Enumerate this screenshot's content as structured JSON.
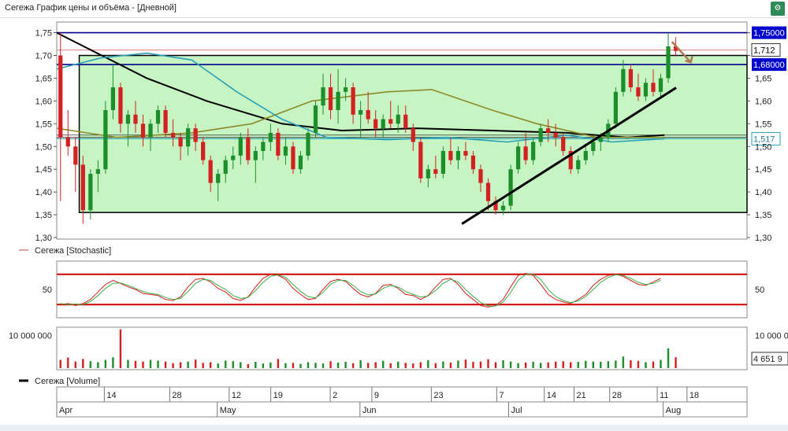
{
  "window": {
    "title": "Сегежа График цены и объёма - [Дневной]",
    "corner_icon": "chart-settings-icon"
  },
  "colors": {
    "up_candle": "#1c8f2b",
    "down_candle": "#d42020",
    "range_box_fill": "#c6f5c3",
    "blue_line": "#00008b",
    "red_line": "#d98080",
    "ma_black": "#000000",
    "ma_olive": "#8b8b2a",
    "ma_teal": "#2aa0b8",
    "stoch_k": "#d42020",
    "stoch_d": "#3cb043",
    "stoch_band": "#d00000",
    "arrow": "#b07850"
  },
  "chart_data": [
    {
      "type": "candlestick",
      "pane": "price",
      "ylim": [
        1.3,
        1.77
      ],
      "y_ticks": [
        "1,30",
        "1,35",
        "1,40",
        "1,45",
        "1,50",
        "1,55",
        "1,60",
        "1,65",
        "1,70",
        "1,75"
      ],
      "grid": false,
      "ohlc": [
        [
          1.7,
          1.75,
          1.38,
          1.52
        ],
        [
          1.52,
          1.58,
          1.48,
          1.5
        ],
        [
          1.5,
          1.52,
          1.4,
          1.46
        ],
        [
          1.46,
          1.48,
          1.33,
          1.36
        ],
        [
          1.36,
          1.45,
          1.34,
          1.44
        ],
        [
          1.44,
          1.47,
          1.4,
          1.45
        ],
        [
          1.45,
          1.6,
          1.44,
          1.58
        ],
        [
          1.58,
          1.68,
          1.56,
          1.63
        ],
        [
          1.63,
          1.64,
          1.53,
          1.55
        ],
        [
          1.55,
          1.58,
          1.5,
          1.57
        ],
        [
          1.57,
          1.6,
          1.53,
          1.55
        ],
        [
          1.55,
          1.57,
          1.5,
          1.52
        ],
        [
          1.52,
          1.56,
          1.49,
          1.55
        ],
        [
          1.55,
          1.59,
          1.53,
          1.58
        ],
        [
          1.58,
          1.59,
          1.52,
          1.53
        ],
        [
          1.53,
          1.56,
          1.5,
          1.52
        ],
        [
          1.52,
          1.53,
          1.47,
          1.5
        ],
        [
          1.5,
          1.55,
          1.48,
          1.54
        ],
        [
          1.54,
          1.55,
          1.49,
          1.51
        ],
        [
          1.51,
          1.52,
          1.46,
          1.47
        ],
        [
          1.47,
          1.48,
          1.4,
          1.42
        ],
        [
          1.42,
          1.45,
          1.38,
          1.44
        ],
        [
          1.44,
          1.48,
          1.42,
          1.47
        ],
        [
          1.47,
          1.5,
          1.45,
          1.48
        ],
        [
          1.48,
          1.53,
          1.46,
          1.52
        ],
        [
          1.52,
          1.54,
          1.46,
          1.47
        ],
        [
          1.47,
          1.5,
          1.42,
          1.49
        ],
        [
          1.49,
          1.52,
          1.47,
          1.51
        ],
        [
          1.51,
          1.55,
          1.49,
          1.53
        ],
        [
          1.53,
          1.54,
          1.47,
          1.48
        ],
        [
          1.48,
          1.52,
          1.46,
          1.5
        ],
        [
          1.5,
          1.51,
          1.44,
          1.45
        ],
        [
          1.45,
          1.49,
          1.44,
          1.48
        ],
        [
          1.48,
          1.54,
          1.47,
          1.53
        ],
        [
          1.53,
          1.6,
          1.52,
          1.59
        ],
        [
          1.59,
          1.66,
          1.57,
          1.63
        ],
        [
          1.63,
          1.66,
          1.56,
          1.58
        ],
        [
          1.58,
          1.67,
          1.55,
          1.62
        ],
        [
          1.62,
          1.65,
          1.6,
          1.63
        ],
        [
          1.63,
          1.64,
          1.55,
          1.57
        ],
        [
          1.57,
          1.6,
          1.52,
          1.58
        ],
        [
          1.58,
          1.62,
          1.55,
          1.56
        ],
        [
          1.56,
          1.58,
          1.52,
          1.54
        ],
        [
          1.54,
          1.57,
          1.52,
          1.56
        ],
        [
          1.56,
          1.6,
          1.54,
          1.55
        ],
        [
          1.55,
          1.59,
          1.53,
          1.57
        ],
        [
          1.57,
          1.59,
          1.53,
          1.54
        ],
        [
          1.54,
          1.55,
          1.49,
          1.51
        ],
        [
          1.51,
          1.52,
          1.42,
          1.43
        ],
        [
          1.43,
          1.46,
          1.41,
          1.45
        ],
        [
          1.45,
          1.48,
          1.43,
          1.44
        ],
        [
          1.44,
          1.5,
          1.43,
          1.49
        ],
        [
          1.49,
          1.52,
          1.46,
          1.47
        ],
        [
          1.47,
          1.5,
          1.45,
          1.49
        ],
        [
          1.49,
          1.51,
          1.47,
          1.48
        ],
        [
          1.48,
          1.49,
          1.44,
          1.45
        ],
        [
          1.45,
          1.46,
          1.4,
          1.42
        ],
        [
          1.42,
          1.43,
          1.36,
          1.38
        ],
        [
          1.38,
          1.39,
          1.35,
          1.36
        ],
        [
          1.36,
          1.38,
          1.35,
          1.37
        ],
        [
          1.37,
          1.46,
          1.36,
          1.45
        ],
        [
          1.45,
          1.51,
          1.44,
          1.5
        ],
        [
          1.5,
          1.53,
          1.46,
          1.47
        ],
        [
          1.47,
          1.52,
          1.46,
          1.51
        ],
        [
          1.51,
          1.55,
          1.5,
          1.54
        ],
        [
          1.54,
          1.56,
          1.51,
          1.53
        ],
        [
          1.53,
          1.55,
          1.5,
          1.52
        ],
        [
          1.52,
          1.53,
          1.48,
          1.49
        ],
        [
          1.49,
          1.5,
          1.44,
          1.45
        ],
        [
          1.45,
          1.48,
          1.44,
          1.47
        ],
        [
          1.47,
          1.5,
          1.46,
          1.49
        ],
        [
          1.49,
          1.52,
          1.48,
          1.51
        ],
        [
          1.51,
          1.53,
          1.49,
          1.52
        ],
        [
          1.52,
          1.56,
          1.51,
          1.55
        ],
        [
          1.55,
          1.63,
          1.54,
          1.62
        ],
        [
          1.62,
          1.69,
          1.61,
          1.67
        ],
        [
          1.67,
          1.68,
          1.62,
          1.63
        ],
        [
          1.63,
          1.66,
          1.6,
          1.61
        ],
        [
          1.61,
          1.65,
          1.6,
          1.64
        ],
        [
          1.64,
          1.67,
          1.61,
          1.62
        ],
        [
          1.62,
          1.66,
          1.61,
          1.65
        ],
        [
          1.65,
          1.75,
          1.64,
          1.72
        ],
        [
          1.72,
          1.74,
          1.7,
          1.71
        ]
      ],
      "x_range": [
        0,
        92
      ],
      "range_box": {
        "x1": 3,
        "x2": 92,
        "y_low": 1.355,
        "y_high": 1.7
      },
      "levels": [
        {
          "y": 1.75,
          "label": "1,75000",
          "style": "blue"
        },
        {
          "y": 1.68,
          "label": "1,68000",
          "style": "blue"
        },
        {
          "y": 1.712,
          "label": "1,712",
          "style": "red"
        },
        {
          "y": 1.517,
          "label": "1,517",
          "style": "teal-box"
        },
        {
          "y": 1.525,
          "style": "dark"
        },
        {
          "y": 1.52,
          "style": "dark"
        }
      ],
      "trendlines": [
        {
          "x1": 54,
          "y1": 1.33,
          "x2": 96,
          "y2": 1.77
        }
      ],
      "arrow": {
        "x1": 82,
        "y1": 1.73,
        "x2": 84.5,
        "y2": 1.685
      },
      "moving_averages": [
        {
          "color": "black",
          "points": [
            [
              0,
              1.75
            ],
            [
              6,
              1.7
            ],
            [
              12,
              1.65
            ],
            [
              20,
              1.6
            ],
            [
              30,
              1.55
            ],
            [
              38,
              1.535
            ],
            [
              48,
              1.54
            ],
            [
              58,
              1.535
            ],
            [
              68,
              1.53
            ],
            [
              76,
              1.52
            ],
            [
              81,
              1.525
            ]
          ]
        },
        {
          "color": "olive",
          "points": [
            [
              0,
              1.54
            ],
            [
              8,
              1.52
            ],
            [
              18,
              1.53
            ],
            [
              26,
              1.55
            ],
            [
              34,
              1.6
            ],
            [
              44,
              1.62
            ],
            [
              50,
              1.625
            ],
            [
              58,
              1.58
            ],
            [
              64,
              1.55
            ],
            [
              72,
              1.52
            ],
            [
              81,
              1.52
            ]
          ]
        },
        {
          "color": "teal",
          "points": [
            [
              0,
              1.67
            ],
            [
              6,
              1.695
            ],
            [
              12,
              1.705
            ],
            [
              18,
              1.69
            ],
            [
              24,
              1.62
            ],
            [
              30,
              1.56
            ],
            [
              36,
              1.52
            ],
            [
              44,
              1.515
            ],
            [
              52,
              1.52
            ],
            [
              60,
              1.51
            ],
            [
              68,
              1.525
            ],
            [
              74,
              1.51
            ],
            [
              81,
              1.517
            ]
          ]
        }
      ]
    },
    {
      "type": "line",
      "pane": "stochastic",
      "title": "Сегежа [Stochastic]",
      "ylim": [
        0,
        100
      ],
      "y_ticks": [
        "50"
      ],
      "bands": [
        80,
        20
      ],
      "series": [
        {
          "color": "red",
          "values": [
            20,
            22,
            18,
            22,
            30,
            45,
            60,
            68,
            62,
            55,
            50,
            42,
            40,
            38,
            30,
            28,
            35,
            55,
            70,
            72,
            65,
            52,
            45,
            32,
            28,
            35,
            55,
            72,
            80,
            78,
            70,
            52,
            40,
            30,
            32,
            50,
            66,
            70,
            66,
            52,
            40,
            35,
            42,
            58,
            60,
            52,
            40,
            38,
            30,
            38,
            55,
            70,
            72,
            60,
            42,
            30,
            18,
            15,
            18,
            30,
            55,
            78,
            82,
            78,
            60,
            40,
            30,
            25,
            22,
            30,
            40,
            58,
            70,
            78,
            80,
            76,
            68,
            60,
            58,
            65,
            72
          ]
        },
        {
          "color": "green",
          "values": [
            22,
            20,
            21,
            20,
            26,
            38,
            52,
            62,
            63,
            58,
            52,
            46,
            42,
            40,
            34,
            30,
            32,
            46,
            62,
            70,
            68,
            58,
            50,
            38,
            32,
            34,
            48,
            64,
            76,
            79,
            74,
            60,
            46,
            36,
            33,
            44,
            60,
            68,
            68,
            58,
            46,
            39,
            41,
            52,
            58,
            55,
            46,
            40,
            35,
            37,
            48,
            62,
            70,
            65,
            50,
            36,
            24,
            17,
            17,
            25,
            44,
            68,
            80,
            80,
            70,
            50,
            36,
            28,
            24,
            27,
            36,
            50,
            64,
            74,
            79,
            78,
            72,
            64,
            60,
            62,
            68
          ]
        }
      ]
    },
    {
      "type": "bar",
      "pane": "volume",
      "title": "Сегежа [Volume]",
      "y_ticks": [
        "10 000 000"
      ],
      "last_value_label": "4 651 9",
      "values": [
        2.5,
        3.2,
        2.0,
        2.8,
        2.1,
        1.8,
        2.5,
        3.3,
        11.8,
        2.5,
        2.2,
        2.0,
        2.5,
        2.3,
        2.0,
        1.5,
        1.8,
        2.0,
        2.6,
        1.6,
        1.8,
        1.4,
        2.3,
        2.1,
        1.8,
        1.2,
        1.9,
        1.4,
        1.7,
        2.8,
        1.5,
        1.6,
        1.3,
        1.8,
        1.6,
        1.4,
        2.1,
        1.7,
        1.9,
        1.5,
        2.4,
        1.6,
        1.8,
        2.2,
        1.5,
        2.0,
        1.6,
        1.4,
        1.8,
        2.4,
        1.5,
        2.0,
        1.7,
        2.3,
        2.6,
        1.9,
        2.0,
        2.7,
        1.8,
        2.4,
        2.0,
        1.5,
        1.7,
        1.9,
        1.6,
        1.7,
        2.0,
        2.1,
        1.8,
        1.9,
        2.2,
        2.0,
        1.9,
        2.1,
        2.3,
        3.5,
        2.4,
        2.2,
        1.8,
        2.0,
        2.5,
        6.0,
        3.3
      ],
      "colors_up": "green",
      "colors_down": "red"
    }
  ],
  "x_axis": {
    "day_ticks": [
      "14",
      "28",
      "12",
      "19",
      "2",
      "9",
      "23",
      "7",
      "14",
      "21",
      "28",
      "11",
      "18"
    ],
    "months": [
      "Apr",
      "May",
      "Jun",
      "Jul",
      "Aug"
    ]
  }
}
